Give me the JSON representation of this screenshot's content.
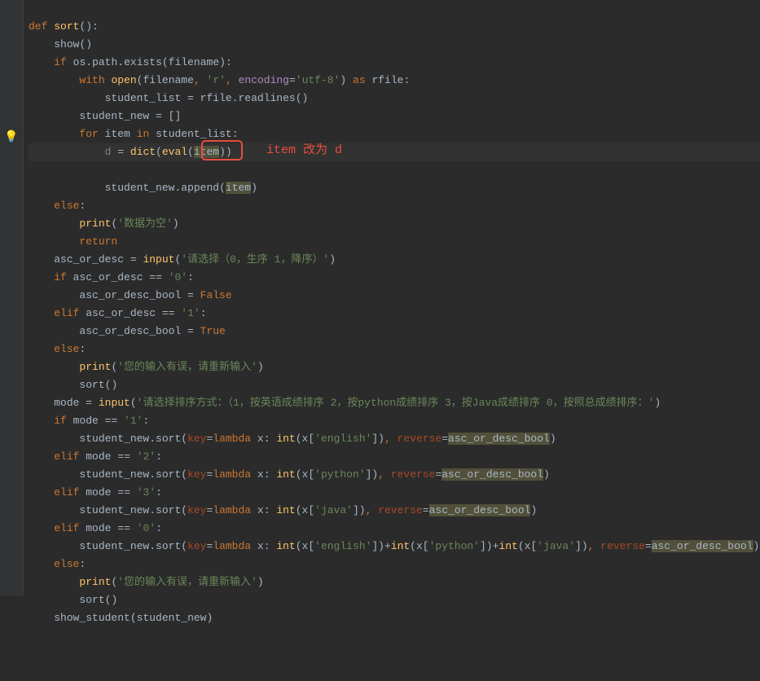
{
  "gutter": {
    "bulb_icon": "💡"
  },
  "annotation": {
    "text": "item 改为 d"
  },
  "tokens": {
    "def": "def",
    "sort": "sort",
    "show": "show",
    "if": "if",
    "os": "os",
    "path": "path",
    "exists": "exists",
    "filename": "filename",
    "with": "with",
    "open": "open",
    "r": "'r'",
    "encoding": "encoding",
    "utf8": "'utf-8'",
    "as": "as",
    "rfile": "rfile",
    "student_list": "student_list",
    "readlines": "readlines",
    "student_new": "student_new",
    "for": "for",
    "item": "item",
    "in": "in",
    "d": "d",
    "dict": "dict",
    "eval": "eval",
    "append": "append",
    "else": "else",
    "print": "print",
    "empty_data": "'数据为空'",
    "return": "return",
    "asc_or_desc": "asc_or_desc",
    "input": "input",
    "select_prompt": "'请选择（0，生序 1，降序）'",
    "zero": "'0'",
    "asc_or_desc_bool": "asc_or_desc_bool",
    "False": "False",
    "elif": "elif",
    "one": "'1'",
    "True": "True",
    "invalid_input": "'您的输入有误，请重新输入'",
    "mode": "mode",
    "mode_prompt": "'请选择排序方式：（1，按英语成绩排序 2，按python成绩排序 3，按Java成绩排序 0，按照总成绩排序：'",
    "key": "key",
    "lambda": "lambda",
    "x": "x",
    "int": "int",
    "english": "'english'",
    "reverse": "reverse",
    "two": "'2'",
    "python": "'python'",
    "three": "'3'",
    "java": "'java'",
    "show_student": "show_student"
  }
}
